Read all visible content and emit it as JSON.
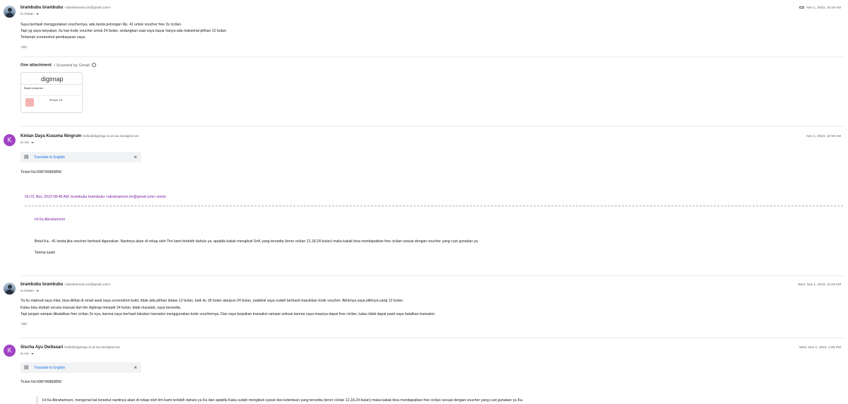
{
  "messages": [
    {
      "sender": "brambubu brambubu",
      "email": "<abrahamson.im@gmail.com>",
      "recipient": "to Kintan",
      "date": "Nov 1, 2023, 10:18 AM",
      "body": [
        "Saya berhasil menggunakan vouchernya, ada tanda potongan Rp. 41 untuk voucher free 3x cicilan.",
        "Tapi yg saya tanyakan, itu kan kode voucher untuk 24 bulan, sedangkan saat saya bayar hanya ada maksimal pilihan 12 bulan.",
        "Terlampir screenshot pembayaran saya."
      ],
      "attachment": {
        "title": "One attachment",
        "scan": "• Scanned by Gmail",
        "logo": "digimap",
        "line1": "Bayar pesanan",
        "product": "iPhone 15"
      }
    },
    {
      "sender": "Kintan Daya Kusuma Ningrum",
      "email": "hello@digimap.co.id via sendgrid.net",
      "recipient": "to me",
      "avatar_letter": "K",
      "date": "Nov 1, 2023, 10:59 AM",
      "translate": "Translate to English",
      "ticket": "Ticket No:698746869858",
      "quote_head": "On 01 Nov, 2023 08:48 AM, brambubu brambubu <abrahamson.im@gmail.com> wrote:",
      "greeting": "Hi Ka Abrahamson",
      "body": "Betul Ka, -41 tanda jika voucher berhasil digunakan. Nantinya akan di rekap oleh Tim kami terlebih dahulu ya, apabila kakak mengikuti SnK yang tersedia (tenor cicilan 12,18,24 bulan) maka kakak bisa mendapatkan free cicilan sesuai dengan voucher yang cust gunakan ya.",
      "closing": "Terima kasih"
    },
    {
      "sender": "brambubu brambubu",
      "email": "<abrahamson.im@gmail.com>",
      "recipient": "to Kintan",
      "date": "Wed, Nov 1, 2023, 11:03 AM",
      "body": [
        "Ya itu maksud saya mba, bisa dilihat di email awal saya screenshot bukti, tidak ada pilihan diatas 12 bulan, baik itu 18 bulan ataupun 24 bulan, padahal saya sudah berhasil masukkan kode voucher. Akhirnya saya pilihnya yang 12 bulan.",
        "Kalau bisa diubah secara manual dari tim digimap menjadi 24 bulan, tidak masalah, saya bersedia.",
        "Tapi jangan sampai dibatalkan free cicilan 3x nya, karena saya berhasil lakukan transaksi menggunakan kode vouchernya. Dan saya lanjutkan transaksi sampai selesai karena saya maunya dapat free cicilan, kalau tidak dapat pasti saya batalkan transaksi."
      ]
    },
    {
      "sender": "Sischa Ayu Dwitasari",
      "email": "hello@digimap.co.id via sendgrid.net",
      "recipient": "to me",
      "avatar_letter": "K",
      "date": "Wed, Nov 1, 2023, 1:56 PM",
      "translate": "Translate to English",
      "ticket": "Ticket No:698746869858",
      "body": "Hi Ka Abrahamson, mengenai hal tersebut nantinya akan di rekap oleh tim kami terlebih dahulu ya Ka dan apabila Kaka sudah mengikuti syarat dan ketentuan yang tersedia  (tenor cicilan 12,18,24 bulan) maka kakak bisa mendapatkan free cicilan sesuai dengan voucher yang cust gunakan ya Ka."
    }
  ],
  "colors": {
    "avatar_purple": "#a142c4",
    "link_blue": "#1a73e8",
    "quote_purple": "#7b1fa2"
  },
  "icons": {
    "translate": "translate-icon",
    "close": "close-icon",
    "more": "more-dots-icon",
    "label": "label-icon"
  }
}
